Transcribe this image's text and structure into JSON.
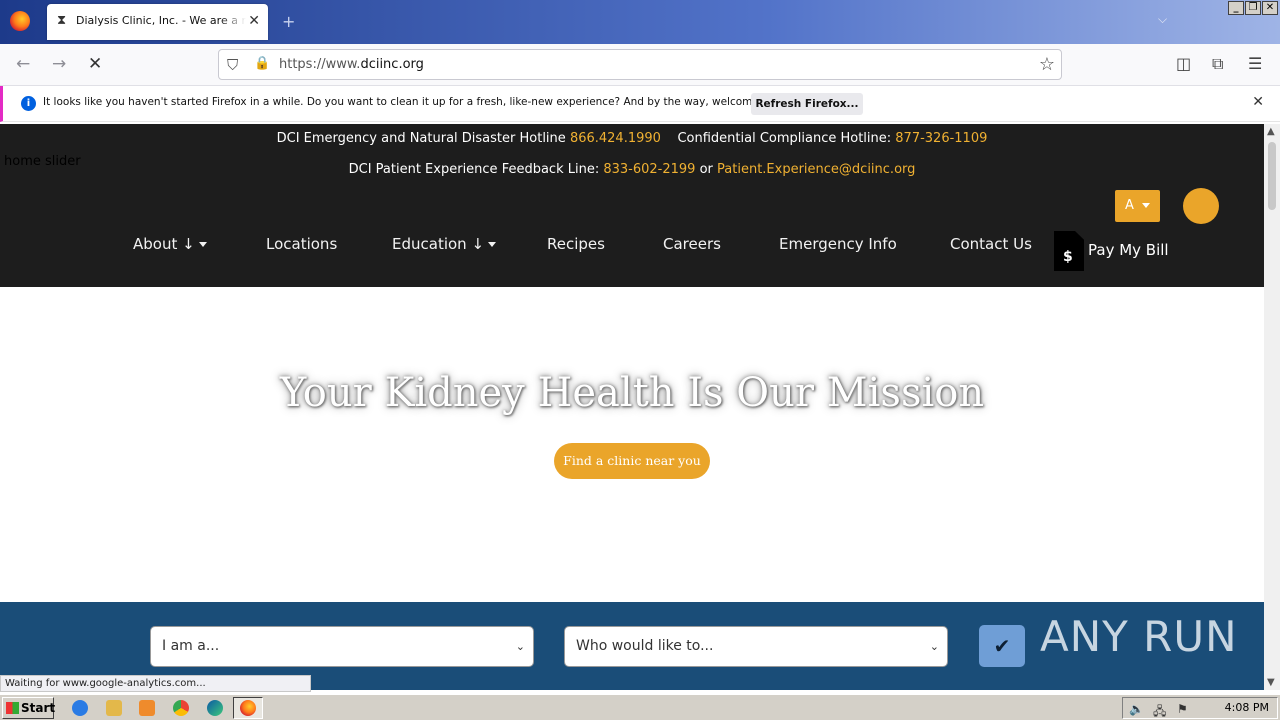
{
  "browser": {
    "tab_title": "Dialysis Clinic, Inc. - We are a not-for-profit",
    "url_prefix": "https://www.",
    "url_domain": "dciinc.org",
    "status_text": "Waiting for www.google-analytics.com..."
  },
  "notification": {
    "message": "It looks like you haven't started Firefox in a while. Do you want to clean it up for a fresh, like-new experience? And by the way, welcome back!",
    "button_label": "Refresh Firefox..."
  },
  "page": {
    "hotline1_label": "DCI Emergency and Natural Disaster Hotline",
    "hotline1_number": "866.424.1990",
    "hotline2_label": "Confidential Compliance Hotline:",
    "hotline2_number": "877-326-1109",
    "feedback_label": "DCI Patient Experience Feedback Line:",
    "feedback_number": "833-602-2199",
    "feedback_or": "or",
    "feedback_email": "Patient.Experience@dciinc.org",
    "slider_alt": "home slider",
    "lang_label": "A",
    "menu": {
      "about": "About ↓",
      "locations": "Locations",
      "education": "Education ↓",
      "recipes": "Recipes",
      "careers": "Careers",
      "emergency": "Emergency Info",
      "contact": "Contact Us",
      "pay_bill": "Pay My Bill"
    },
    "hero_title": "Your Kidney Health Is Our Mission",
    "hero_button": "Find a clinic near you",
    "select1": "I am a...",
    "select2": "Who would like to...",
    "watermark": "ANY RUN"
  },
  "taskbar": {
    "start_label": "Start",
    "clock": "4:08 PM"
  },
  "colors": {
    "accent": "#eaa52a",
    "header_bg": "#1d1d1d",
    "band_bg": "#1a4d78"
  }
}
